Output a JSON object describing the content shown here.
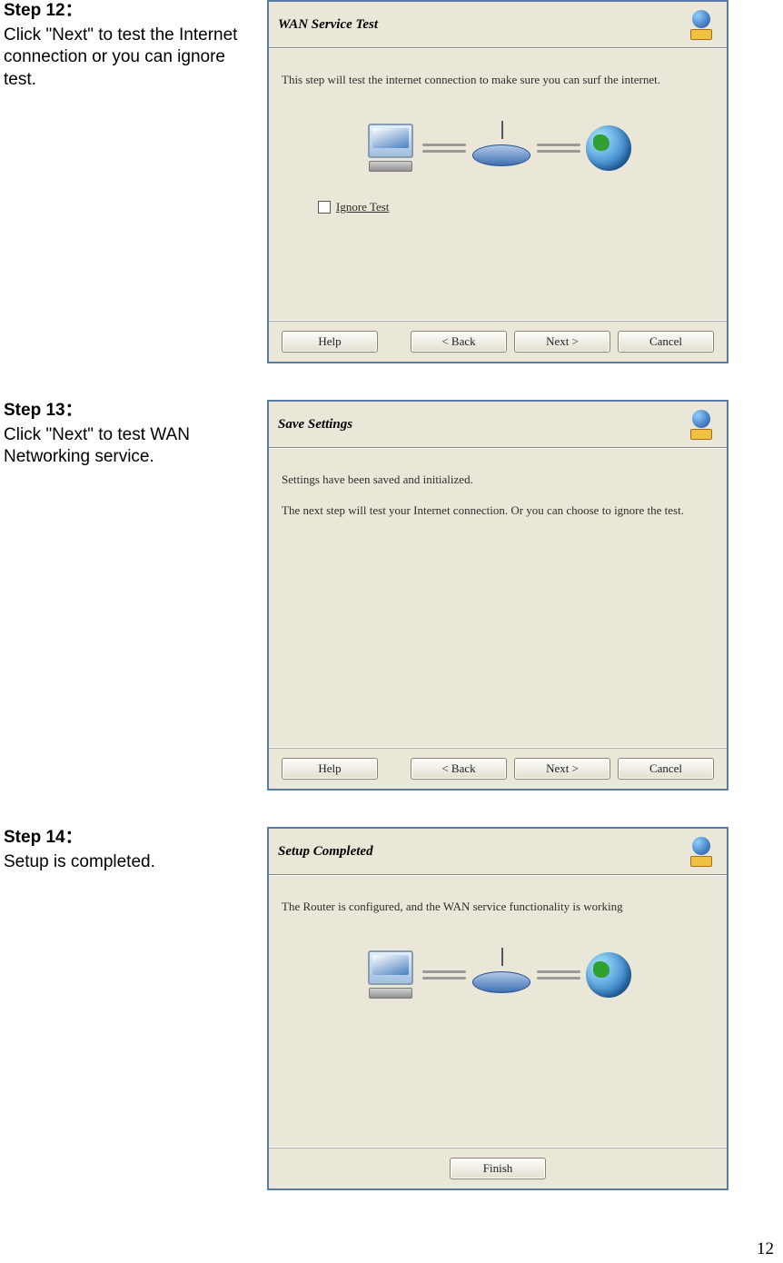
{
  "page_number": "12",
  "steps": [
    {
      "title": "Step 12：",
      "text": "Click \"Next\" to test the Internet connection or you can ignore test.",
      "dialog": {
        "header_title": "WAN Service Test",
        "body_lines": [
          "This step will test the internet connection to make sure you can surf the internet."
        ],
        "checkbox_label": "Ignore Test",
        "show_diagram": true,
        "show_checkbox": true,
        "buttons": {
          "help": "Help",
          "back": "< Back",
          "next": "Next >",
          "cancel": "Cancel"
        }
      }
    },
    {
      "title": "Step 13：",
      "text": "Click \"Next\" to test WAN Networking service.",
      "dialog": {
        "header_title": "Save Settings",
        "body_lines": [
          "Settings have been saved and initialized.",
          "The next step will test your Internet connection. Or you can choose to ignore the test."
        ],
        "show_diagram": false,
        "show_checkbox": false,
        "buttons": {
          "help": "Help",
          "back": "< Back",
          "next": "Next >",
          "cancel": "Cancel"
        }
      }
    },
    {
      "title": "Step 14：",
      "text": "Setup is completed.",
      "dialog": {
        "header_title": "Setup Completed",
        "body_lines": [
          "The Router is configured, and the WAN service functionality is working"
        ],
        "show_diagram": true,
        "show_checkbox": false,
        "buttons": {
          "finish": "Finish"
        }
      }
    }
  ]
}
